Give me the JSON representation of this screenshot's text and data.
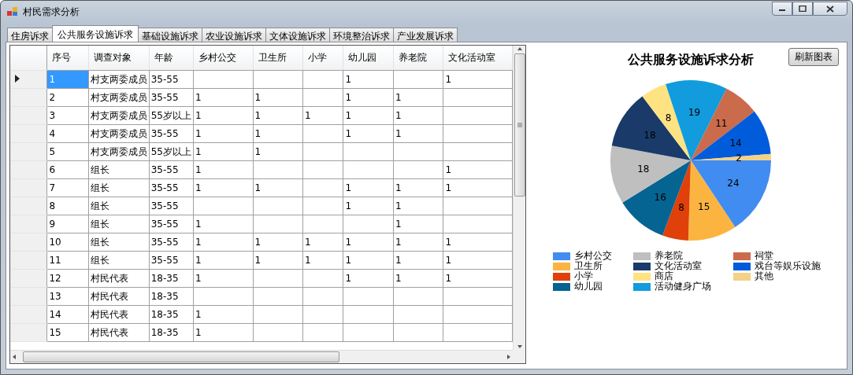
{
  "window": {
    "title": "村民需求分析"
  },
  "tabs": [
    {
      "label": "住房诉求",
      "selected": false
    },
    {
      "label": "公共服务设施诉求",
      "selected": true
    },
    {
      "label": "基础设施诉求",
      "selected": false
    },
    {
      "label": "农业设施诉求",
      "selected": false
    },
    {
      "label": "文体设施诉求",
      "selected": false
    },
    {
      "label": "环境整治诉求",
      "selected": false
    },
    {
      "label": "产业发展诉求",
      "selected": false
    }
  ],
  "table": {
    "columns": [
      "序号",
      "调查对象",
      "年龄",
      "乡村公交",
      "卫生所",
      "小学",
      "幼儿园",
      "养老院",
      "文化活动室"
    ],
    "rows": [
      {
        "selected": true,
        "cells": [
          "1",
          "村支两委成员",
          "35-55",
          null,
          null,
          null,
          "1",
          null,
          "1"
        ]
      },
      {
        "selected": false,
        "cells": [
          "2",
          "村支两委成员",
          "35-55",
          "1",
          "1",
          null,
          "1",
          "1",
          null
        ]
      },
      {
        "selected": false,
        "cells": [
          "3",
          "村支两委成员",
          "55岁以上",
          "1",
          "1",
          "1",
          "1",
          "1",
          null
        ]
      },
      {
        "selected": false,
        "cells": [
          "4",
          "村支两委成员",
          "35-55",
          "1",
          "1",
          null,
          "1",
          "1",
          null
        ]
      },
      {
        "selected": false,
        "cells": [
          "5",
          "村支两委成员",
          "55岁以上",
          "1",
          "1",
          null,
          null,
          null,
          null
        ]
      },
      {
        "selected": false,
        "cells": [
          "6",
          "组长",
          "35-55",
          "1",
          null,
          null,
          null,
          null,
          "1"
        ]
      },
      {
        "selected": false,
        "cells": [
          "7",
          "组长",
          "35-55",
          "1",
          "1",
          null,
          "1",
          "1",
          "1"
        ]
      },
      {
        "selected": false,
        "cells": [
          "8",
          "组长",
          "35-55",
          null,
          null,
          null,
          "1",
          "1",
          null
        ]
      },
      {
        "selected": false,
        "cells": [
          "9",
          "组长",
          "35-55",
          "1",
          null,
          null,
          null,
          "1",
          null
        ]
      },
      {
        "selected": false,
        "cells": [
          "10",
          "组长",
          "35-55",
          "1",
          "1",
          "1",
          "1",
          "1",
          "1"
        ]
      },
      {
        "selected": false,
        "cells": [
          "11",
          "组长",
          "35-55",
          "1",
          "1",
          "1",
          "1",
          "1",
          "1"
        ]
      },
      {
        "selected": false,
        "cells": [
          "12",
          "村民代表",
          "18-35",
          "1",
          null,
          null,
          "1",
          "1",
          "1"
        ]
      },
      {
        "selected": false,
        "cells": [
          "13",
          "村民代表",
          "18-35",
          null,
          null,
          null,
          null,
          null,
          null
        ]
      },
      {
        "selected": false,
        "cells": [
          "14",
          "村民代表",
          "18-35",
          "1",
          null,
          null,
          null,
          null,
          null
        ]
      },
      {
        "selected": false,
        "cells": [
          "15",
          "村民代表",
          "18-35",
          "1",
          null,
          null,
          null,
          null,
          null
        ]
      }
    ]
  },
  "refresh_button": "刷新图表",
  "chart_data": {
    "type": "pie",
    "title": "公共服务设施诉求分析",
    "data_labels": true,
    "categories": [
      "乡村公交",
      "卫生所",
      "小学",
      "幼儿园",
      "养老院",
      "文化活动室",
      "商店",
      "活动健身广场",
      "祠堂",
      "戏台等娱乐设施",
      "其他"
    ],
    "values": [
      24,
      15,
      8,
      16,
      18,
      18,
      8,
      19,
      11,
      14,
      2
    ],
    "legend": true,
    "colors": [
      "#418cf0",
      "#fcb441",
      "#e0400a",
      "#056492",
      "#bfbfbf",
      "#1a3b69",
      "#ffe382",
      "#129cdd",
      "#ca6b4b",
      "#005cdb",
      "#f3d288"
    ]
  }
}
